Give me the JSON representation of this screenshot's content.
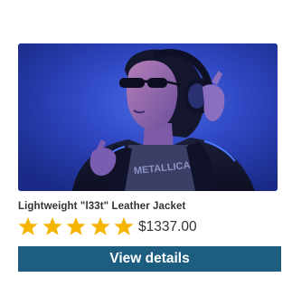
{
  "product": {
    "image_alt": "Person wearing headphones and sunglasses under blue light",
    "name": "Lightweight \"l33t\" Leather Jacket",
    "rating": 5,
    "rating_max": 5,
    "price": "$1337.00"
  },
  "actions": {
    "view_details_label": "View details"
  },
  "colors": {
    "star": "#f4b400",
    "button_bg": "#1d5d80",
    "button_text": "#ffffff",
    "text": "#333333",
    "image_bg": "#2a42b8"
  },
  "icons": {
    "star": "star-icon"
  }
}
